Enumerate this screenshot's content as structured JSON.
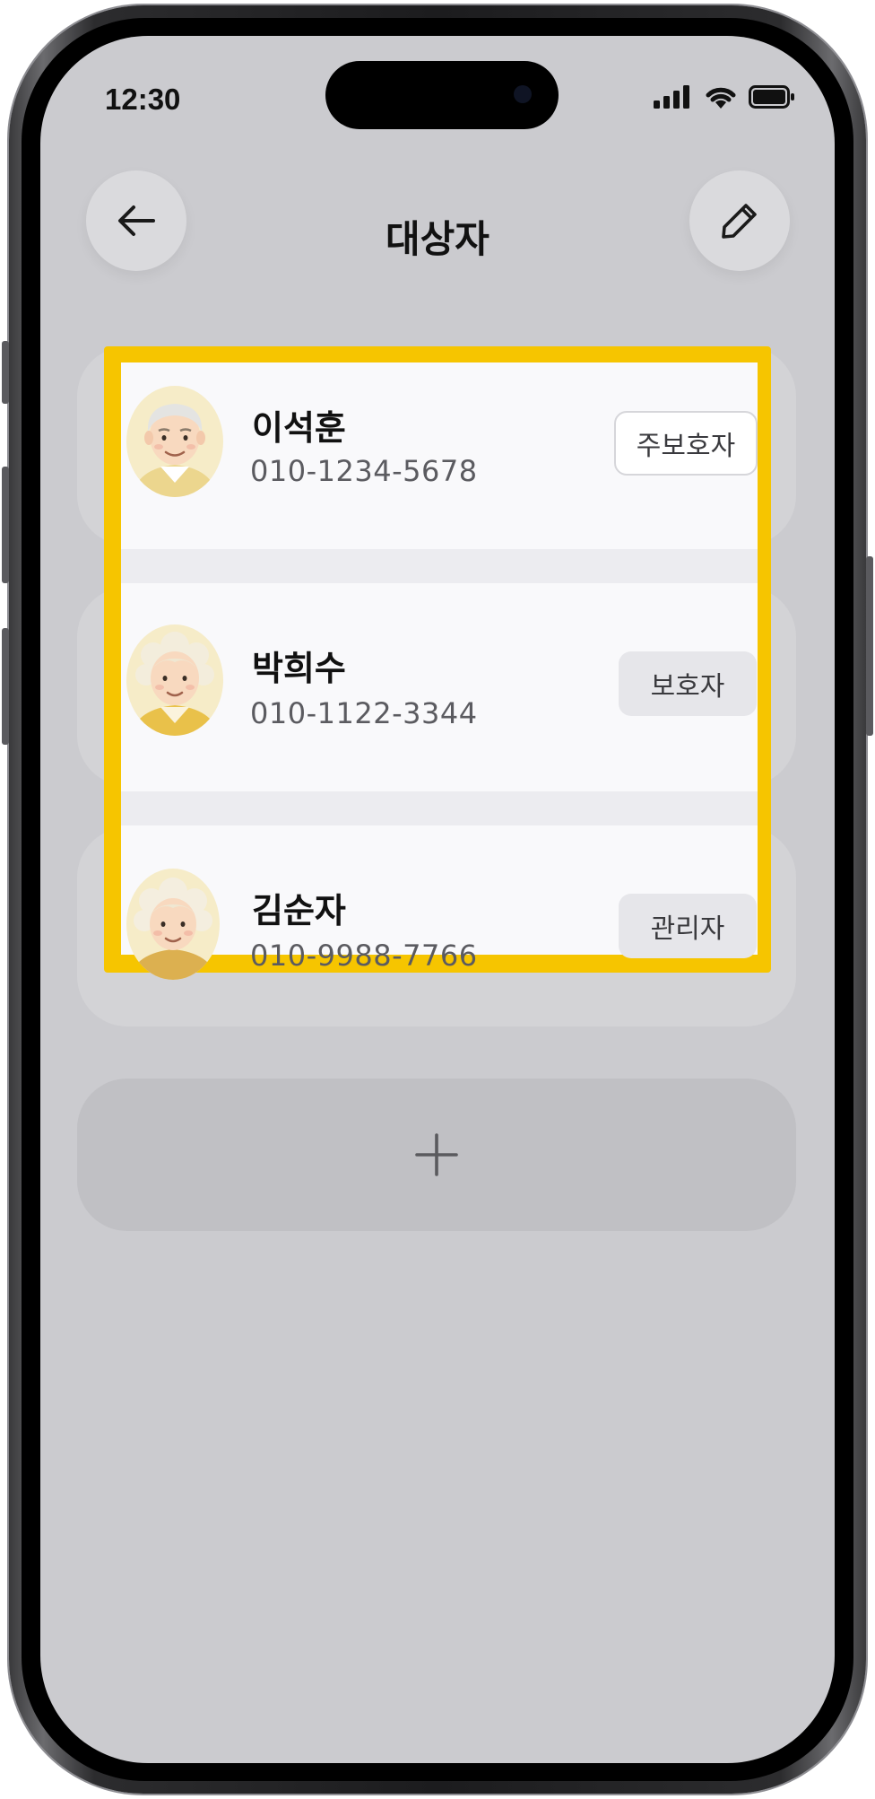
{
  "status_bar": {
    "time": "12:30"
  },
  "header": {
    "title": "대상자",
    "back_icon": "arrow-left-icon",
    "edit_icon": "pencil-icon"
  },
  "subjects": [
    {
      "name": "이석훈",
      "phone": "010-1234-5678",
      "role": "주보호자",
      "avatar": "elderly-man-avatar"
    },
    {
      "name": "박희수",
      "phone": "010-1122-3344",
      "role": "보호자",
      "avatar": "elderly-woman-avatar"
    },
    {
      "name": "김순자",
      "phone": "010-9988-7766",
      "role": "관리자",
      "avatar": "elderly-woman-avatar"
    }
  ],
  "add_button": {
    "icon": "plus-icon"
  },
  "colors": {
    "screen_bg": "#cbcbcf",
    "highlight": "#f6c500",
    "row_bg": "#f9f9fb"
  }
}
